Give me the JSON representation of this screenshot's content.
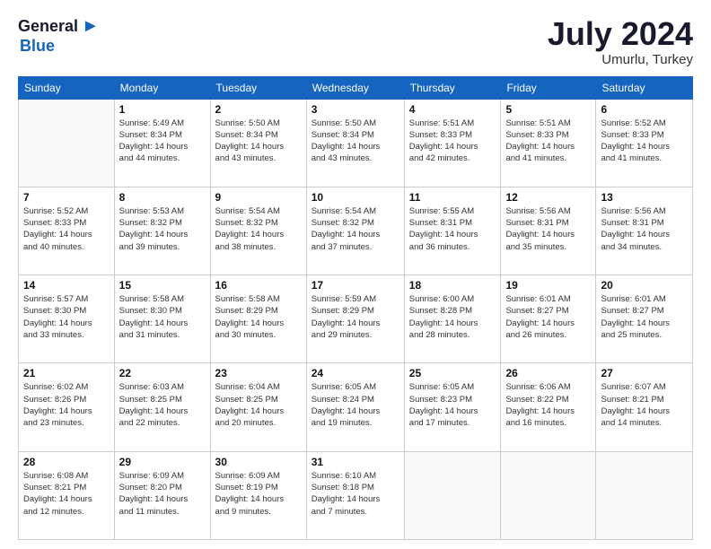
{
  "logo": {
    "line1": "General",
    "line2": "Blue"
  },
  "title": {
    "main": "July 2024",
    "sub": "Umurlu, Turkey"
  },
  "header_days": [
    "Sunday",
    "Monday",
    "Tuesday",
    "Wednesday",
    "Thursday",
    "Friday",
    "Saturday"
  ],
  "weeks": [
    [
      {
        "num": "",
        "info": ""
      },
      {
        "num": "1",
        "info": "Sunrise: 5:49 AM\nSunset: 8:34 PM\nDaylight: 14 hours\nand 44 minutes."
      },
      {
        "num": "2",
        "info": "Sunrise: 5:50 AM\nSunset: 8:34 PM\nDaylight: 14 hours\nand 43 minutes."
      },
      {
        "num": "3",
        "info": "Sunrise: 5:50 AM\nSunset: 8:34 PM\nDaylight: 14 hours\nand 43 minutes."
      },
      {
        "num": "4",
        "info": "Sunrise: 5:51 AM\nSunset: 8:33 PM\nDaylight: 14 hours\nand 42 minutes."
      },
      {
        "num": "5",
        "info": "Sunrise: 5:51 AM\nSunset: 8:33 PM\nDaylight: 14 hours\nand 41 minutes."
      },
      {
        "num": "6",
        "info": "Sunrise: 5:52 AM\nSunset: 8:33 PM\nDaylight: 14 hours\nand 41 minutes."
      }
    ],
    [
      {
        "num": "7",
        "info": "Sunrise: 5:52 AM\nSunset: 8:33 PM\nDaylight: 14 hours\nand 40 minutes."
      },
      {
        "num": "8",
        "info": "Sunrise: 5:53 AM\nSunset: 8:32 PM\nDaylight: 14 hours\nand 39 minutes."
      },
      {
        "num": "9",
        "info": "Sunrise: 5:54 AM\nSunset: 8:32 PM\nDaylight: 14 hours\nand 38 minutes."
      },
      {
        "num": "10",
        "info": "Sunrise: 5:54 AM\nSunset: 8:32 PM\nDaylight: 14 hours\nand 37 minutes."
      },
      {
        "num": "11",
        "info": "Sunrise: 5:55 AM\nSunset: 8:31 PM\nDaylight: 14 hours\nand 36 minutes."
      },
      {
        "num": "12",
        "info": "Sunrise: 5:56 AM\nSunset: 8:31 PM\nDaylight: 14 hours\nand 35 minutes."
      },
      {
        "num": "13",
        "info": "Sunrise: 5:56 AM\nSunset: 8:31 PM\nDaylight: 14 hours\nand 34 minutes."
      }
    ],
    [
      {
        "num": "14",
        "info": "Sunrise: 5:57 AM\nSunset: 8:30 PM\nDaylight: 14 hours\nand 33 minutes."
      },
      {
        "num": "15",
        "info": "Sunrise: 5:58 AM\nSunset: 8:30 PM\nDaylight: 14 hours\nand 31 minutes."
      },
      {
        "num": "16",
        "info": "Sunrise: 5:58 AM\nSunset: 8:29 PM\nDaylight: 14 hours\nand 30 minutes."
      },
      {
        "num": "17",
        "info": "Sunrise: 5:59 AM\nSunset: 8:29 PM\nDaylight: 14 hours\nand 29 minutes."
      },
      {
        "num": "18",
        "info": "Sunrise: 6:00 AM\nSunset: 8:28 PM\nDaylight: 14 hours\nand 28 minutes."
      },
      {
        "num": "19",
        "info": "Sunrise: 6:01 AM\nSunset: 8:27 PM\nDaylight: 14 hours\nand 26 minutes."
      },
      {
        "num": "20",
        "info": "Sunrise: 6:01 AM\nSunset: 8:27 PM\nDaylight: 14 hours\nand 25 minutes."
      }
    ],
    [
      {
        "num": "21",
        "info": "Sunrise: 6:02 AM\nSunset: 8:26 PM\nDaylight: 14 hours\nand 23 minutes."
      },
      {
        "num": "22",
        "info": "Sunrise: 6:03 AM\nSunset: 8:25 PM\nDaylight: 14 hours\nand 22 minutes."
      },
      {
        "num": "23",
        "info": "Sunrise: 6:04 AM\nSunset: 8:25 PM\nDaylight: 14 hours\nand 20 minutes."
      },
      {
        "num": "24",
        "info": "Sunrise: 6:05 AM\nSunset: 8:24 PM\nDaylight: 14 hours\nand 19 minutes."
      },
      {
        "num": "25",
        "info": "Sunrise: 6:05 AM\nSunset: 8:23 PM\nDaylight: 14 hours\nand 17 minutes."
      },
      {
        "num": "26",
        "info": "Sunrise: 6:06 AM\nSunset: 8:22 PM\nDaylight: 14 hours\nand 16 minutes."
      },
      {
        "num": "27",
        "info": "Sunrise: 6:07 AM\nSunset: 8:21 PM\nDaylight: 14 hours\nand 14 minutes."
      }
    ],
    [
      {
        "num": "28",
        "info": "Sunrise: 6:08 AM\nSunset: 8:21 PM\nDaylight: 14 hours\nand 12 minutes."
      },
      {
        "num": "29",
        "info": "Sunrise: 6:09 AM\nSunset: 8:20 PM\nDaylight: 14 hours\nand 11 minutes."
      },
      {
        "num": "30",
        "info": "Sunrise: 6:09 AM\nSunset: 8:19 PM\nDaylight: 14 hours\nand 9 minutes."
      },
      {
        "num": "31",
        "info": "Sunrise: 6:10 AM\nSunset: 8:18 PM\nDaylight: 14 hours\nand 7 minutes."
      },
      {
        "num": "",
        "info": ""
      },
      {
        "num": "",
        "info": ""
      },
      {
        "num": "",
        "info": ""
      }
    ]
  ]
}
